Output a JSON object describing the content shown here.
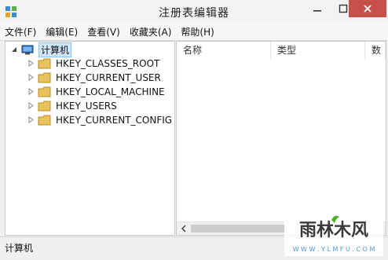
{
  "window": {
    "title": "注册表编辑器",
    "close_color": "#c7504a"
  },
  "menu": {
    "items": [
      "文件(F)",
      "编辑(E)",
      "查看(V)",
      "收藏夹(A)",
      "帮助(H)"
    ]
  },
  "tree": {
    "root": "计算机",
    "children": [
      {
        "label": "HKEY_CLASSES_ROOT"
      },
      {
        "label": "HKEY_CURRENT_USER"
      },
      {
        "label": "HKEY_LOCAL_MACHINE"
      },
      {
        "label": "HKEY_USERS"
      },
      {
        "label": "HKEY_CURRENT_CONFIG"
      }
    ]
  },
  "list": {
    "columns": [
      "名称",
      "类型",
      "数"
    ]
  },
  "status": {
    "path": "计算机"
  },
  "watermark": {
    "brand": "雨林木风",
    "url": "W W W . Y L M F U . C O M"
  }
}
